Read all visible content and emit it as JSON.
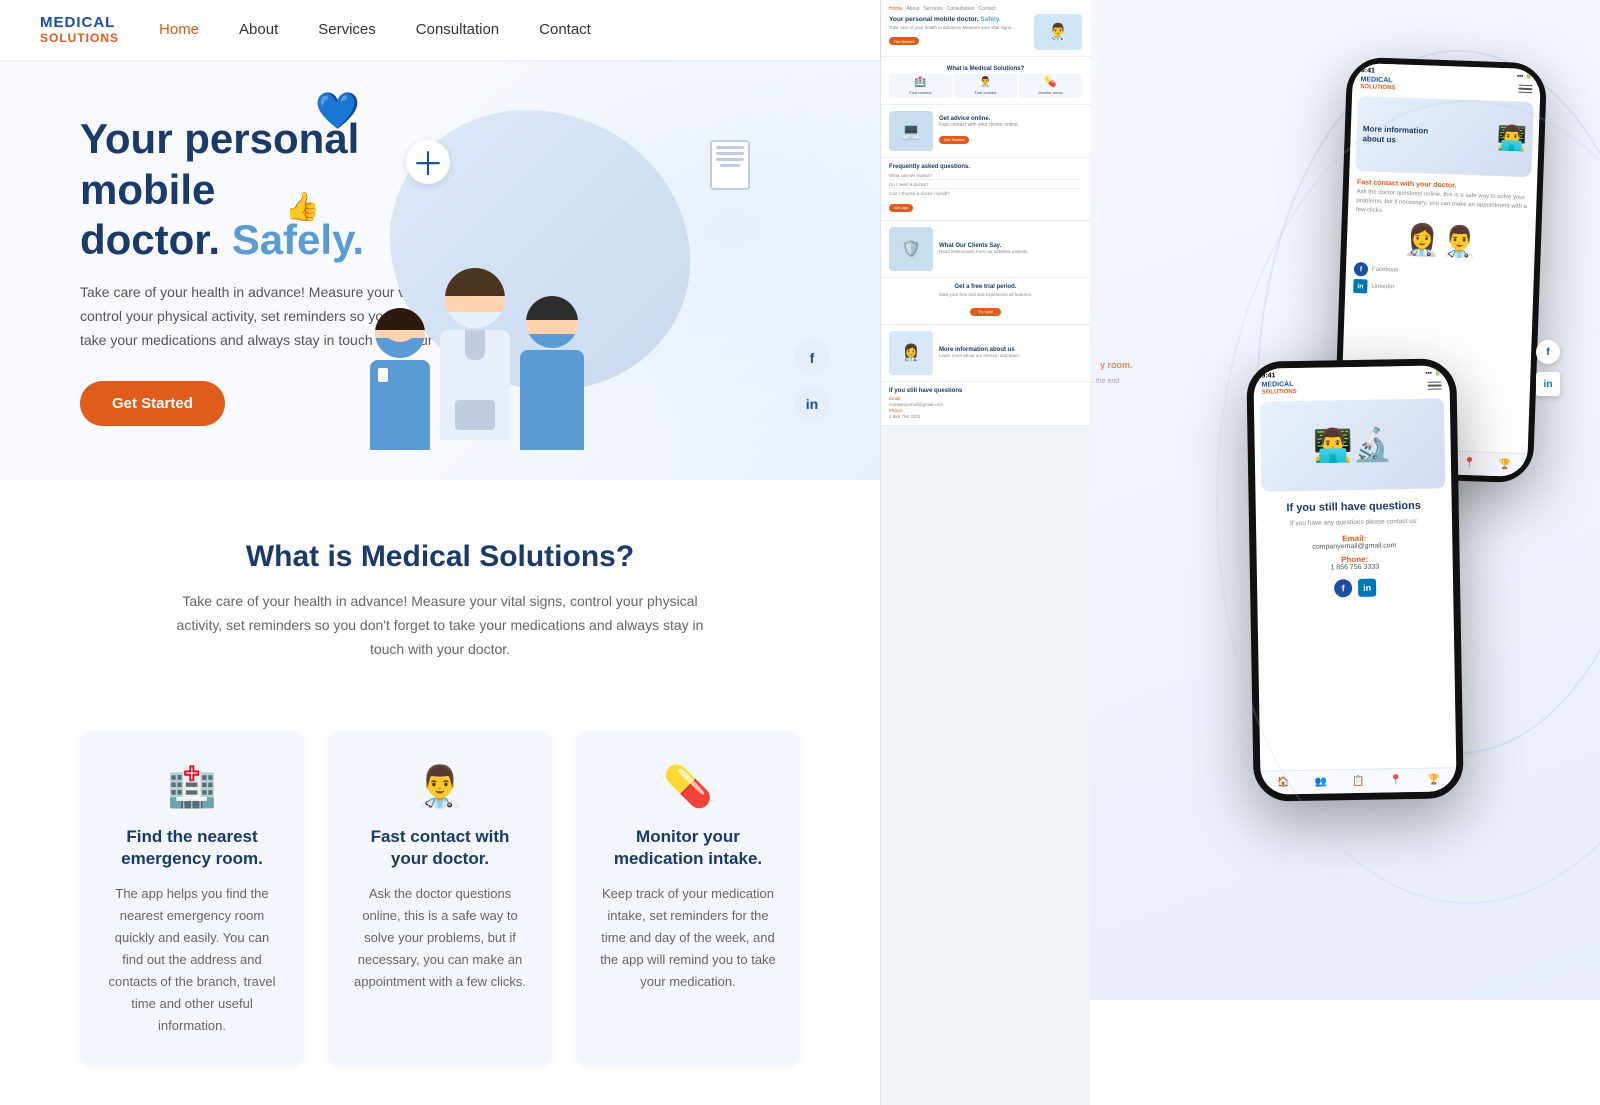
{
  "brand": {
    "name_line1": "MEDICAL",
    "name_line2": "SOLUTIONS"
  },
  "nav": {
    "items": [
      {
        "label": "Home",
        "active": true
      },
      {
        "label": "About",
        "active": false
      },
      {
        "label": "Services",
        "active": false
      },
      {
        "label": "Consultation",
        "active": false
      },
      {
        "label": "Contact",
        "active": false
      }
    ]
  },
  "hero": {
    "title_line1": "Your personal mobile",
    "title_line2": "doctor.",
    "title_accent": "Safely.",
    "description": "Take care of your health in advance! Measure your vital signs, control your physical activity, set reminders so you don't forget to take your medications and always stay in touch with your doctor.",
    "cta_label": "Get Started"
  },
  "what_is": {
    "title": "What is Medical Solutions?",
    "description": "Take care of your health in advance! Measure your vital signs, control your physical activity, set reminders so you don't forget to take your medications and always stay in touch with your doctor."
  },
  "features": [
    {
      "icon": "🏥",
      "title": "Find the nearest emergency room.",
      "description": "The app helps you find the nearest emergency room quickly and easily. You can find out the address and contacts of the branch, travel time and other useful information."
    },
    {
      "icon": "👨‍⚕️",
      "title": "Fast contact with your doctor.",
      "description": "Ask the doctor questions online, this is a safe way to solve your problems, but if necessary, you can make an appointment with a few clicks."
    },
    {
      "icon": "💊",
      "title": "Monitor your medication intake.",
      "description": "Keep track of your medication intake, set reminders for the time and day of the week, and the app will remind you to take your medication."
    }
  ],
  "social": {
    "facebook": "f",
    "linkedin": "in"
  },
  "phone1": {
    "time": "9:41",
    "section": "More information about us",
    "sub": "Fast contact with your doctor.",
    "desc": "Ask the doctor questions online, this is a safe way to solve your problems, but if necessary, you can make an appointment with a few clicks."
  },
  "phone2": {
    "time": "9:41",
    "section": "If you still have questions",
    "desc": "If you have any questions please contact us:",
    "email_label": "Email:",
    "email": "companyemail@gmail.com",
    "phone_label": "Phone:",
    "phone": "1 856 756 3333"
  },
  "sidebar_sections": [
    {
      "type": "hero",
      "label": "Your personal mobile doctor. Safely.",
      "btn": "Get Started"
    },
    {
      "type": "what_is",
      "label": "What is Medical Solutions?"
    },
    {
      "type": "get_advice",
      "label": "Get advice online.",
      "btn": "Get Started"
    },
    {
      "type": "faq",
      "label": "Frequently asked questions."
    },
    {
      "type": "clients",
      "label": "What Our Clients Say."
    },
    {
      "type": "trial",
      "label": "Get a free trial period."
    },
    {
      "type": "more_info",
      "label": "More information about us"
    },
    {
      "type": "questions",
      "label": "If you still have questions"
    }
  ]
}
